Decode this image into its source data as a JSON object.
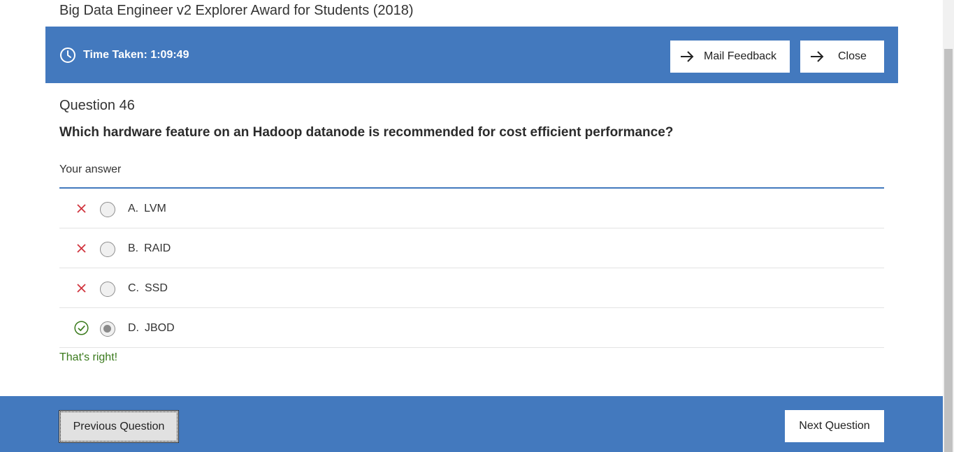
{
  "page_title": "Big Data Engineer v2 Explorer Award for Students (2018)",
  "top_bar": {
    "time_taken": "Time Taken: 1:09:49",
    "mail_feedback_label": "Mail Feedback",
    "close_label": "Close"
  },
  "question": {
    "number_label": "Question 46",
    "text": "Which hardware feature on an Hadoop datanode is recommended for cost efficient performance?",
    "your_answer_label": "Your answer",
    "answers": [
      {
        "letter": "A.",
        "text": "LVM",
        "status": "incorrect",
        "selected": false
      },
      {
        "letter": "B.",
        "text": "RAID",
        "status": "incorrect",
        "selected": false
      },
      {
        "letter": "C.",
        "text": "SSD",
        "status": "incorrect",
        "selected": false
      },
      {
        "letter": "D.",
        "text": "JBOD",
        "status": "correct",
        "selected": true
      }
    ],
    "feedback": "That's right!"
  },
  "bottom_bar": {
    "previous_label": "Previous Question",
    "next_label": "Next Question"
  },
  "colors": {
    "accent": "#4379be",
    "incorrect": "#d0343e",
    "correct": "#3a7a1c"
  }
}
